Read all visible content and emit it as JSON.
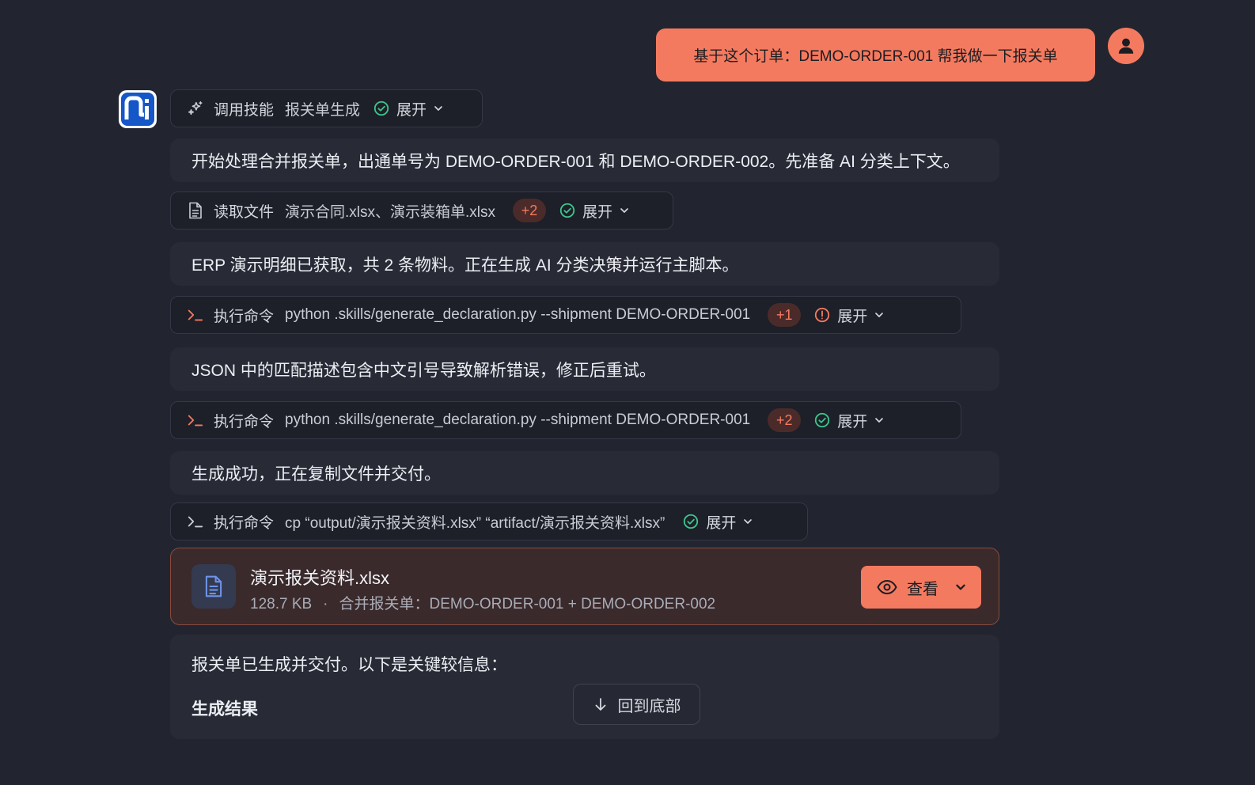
{
  "user_message": "基于这个订单：DEMO-ORDER-001  帮我做一下报关单",
  "skill_step": {
    "label": "调用技能",
    "detail": "报关单生成",
    "expand": "展开"
  },
  "messages": [
    "开始处理合并报关单，出通单号为 DEMO-ORDER-001 和 DEMO-ORDER-002。先准备 AI 分类上下文。",
    "ERP 演示明细已获取，共 2 条物料。正在生成 AI 分类决策并运行主脚本。",
    "JSON 中的匹配描述包含中文引号导致解析错误，修正后重试。",
    "生成成功，正在复制文件并交付。"
  ],
  "read_step": {
    "label": "读取文件",
    "detail": "演示合同.xlsx、演示装箱单.xlsx",
    "count": "+2",
    "expand": "展开"
  },
  "exec_steps": [
    {
      "label": "执行命令",
      "detail": "python .skills/generate_declaration.py --shipment DEMO-ORDER-001",
      "count": "+1",
      "status": "warning",
      "expand": "展开"
    },
    {
      "label": "执行命令",
      "detail": "python .skills/generate_declaration.py --shipment DEMO-ORDER-001",
      "count": "+2",
      "status": "success",
      "expand": "展开"
    },
    {
      "label": "执行命令",
      "detail": "cp “output/演示报关资料.xlsx” “artifact/演示报关资料.xlsx”",
      "status": "success",
      "expand": "展开"
    }
  ],
  "file_card": {
    "name": "演示报关资料.xlsx",
    "size": "128.7 KB",
    "separator": "·",
    "description": "合并报关单：DEMO-ORDER-001 + DEMO-ORDER-002",
    "view_label": "查看"
  },
  "final_message": {
    "line1": "报关单已生成并交付。以下是关键较信息：",
    "heading": "生成结果"
  },
  "scroll_to_bottom": "回到底部",
  "colors": {
    "accent": "#f47a5f",
    "success": "#3ec58a",
    "warning": "#f47a5f",
    "background": "#222530"
  }
}
